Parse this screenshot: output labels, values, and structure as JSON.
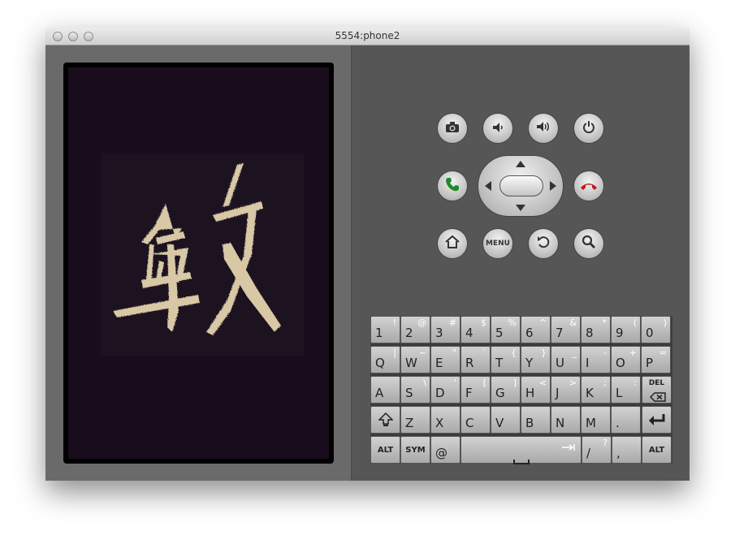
{
  "window": {
    "title": "5554:phone2"
  },
  "screen": {
    "background": "#190c1c"
  },
  "controls": {
    "camera": "camera-icon",
    "volume_down": "volume-down-icon",
    "volume_up": "volume-up-icon",
    "power": "power-icon",
    "call": "call-icon",
    "end_call": "end-call-icon",
    "home": "home-icon",
    "menu_label": "MENU",
    "back": "back-icon",
    "search": "search-icon",
    "call_color": "#1e8a2a",
    "end_color": "#c8141e"
  },
  "keyboard": {
    "row1": [
      {
        "k": "1",
        "a": "!"
      },
      {
        "k": "2",
        "a": "@"
      },
      {
        "k": "3",
        "a": "#"
      },
      {
        "k": "4",
        "a": "$"
      },
      {
        "k": "5",
        "a": "%"
      },
      {
        "k": "6",
        "a": "^"
      },
      {
        "k": "7",
        "a": "&"
      },
      {
        "k": "8",
        "a": "*"
      },
      {
        "k": "9",
        "a": "("
      },
      {
        "k": "0",
        "a": ")"
      }
    ],
    "row2": [
      {
        "k": "Q",
        "a": "|"
      },
      {
        "k": "W",
        "a": "~"
      },
      {
        "k": "E",
        "a": "\""
      },
      {
        "k": "R",
        "a": "`"
      },
      {
        "k": "T",
        "a": "{"
      },
      {
        "k": "Y",
        "a": "}"
      },
      {
        "k": "U",
        "a": "_"
      },
      {
        "k": "I",
        "a": "-"
      },
      {
        "k": "O",
        "a": "+"
      },
      {
        "k": "P",
        "a": "="
      }
    ],
    "row3": [
      {
        "k": "A",
        "a": ""
      },
      {
        "k": "S",
        "a": "\\"
      },
      {
        "k": "D",
        "a": "'"
      },
      {
        "k": "F",
        "a": "["
      },
      {
        "k": "G",
        "a": "]"
      },
      {
        "k": "H",
        "a": "<"
      },
      {
        "k": "J",
        "a": ">"
      },
      {
        "k": "K",
        "a": ";"
      },
      {
        "k": "L",
        "a": ":"
      }
    ],
    "del_label": "DEL",
    "row4": [
      {
        "k": "Z",
        "a": ""
      },
      {
        "k": "X",
        "a": ""
      },
      {
        "k": "C",
        "a": ""
      },
      {
        "k": "V",
        "a": ""
      },
      {
        "k": "B",
        "a": ""
      },
      {
        "k": "N",
        "a": ""
      },
      {
        "k": "M",
        "a": ""
      },
      {
        "k": ".",
        "a": ""
      }
    ],
    "alt_label": "ALT",
    "sym_label": "SYM",
    "at_label": "@",
    "slash_main": "/",
    "slash_alt": "?",
    "comma_main": ","
  }
}
